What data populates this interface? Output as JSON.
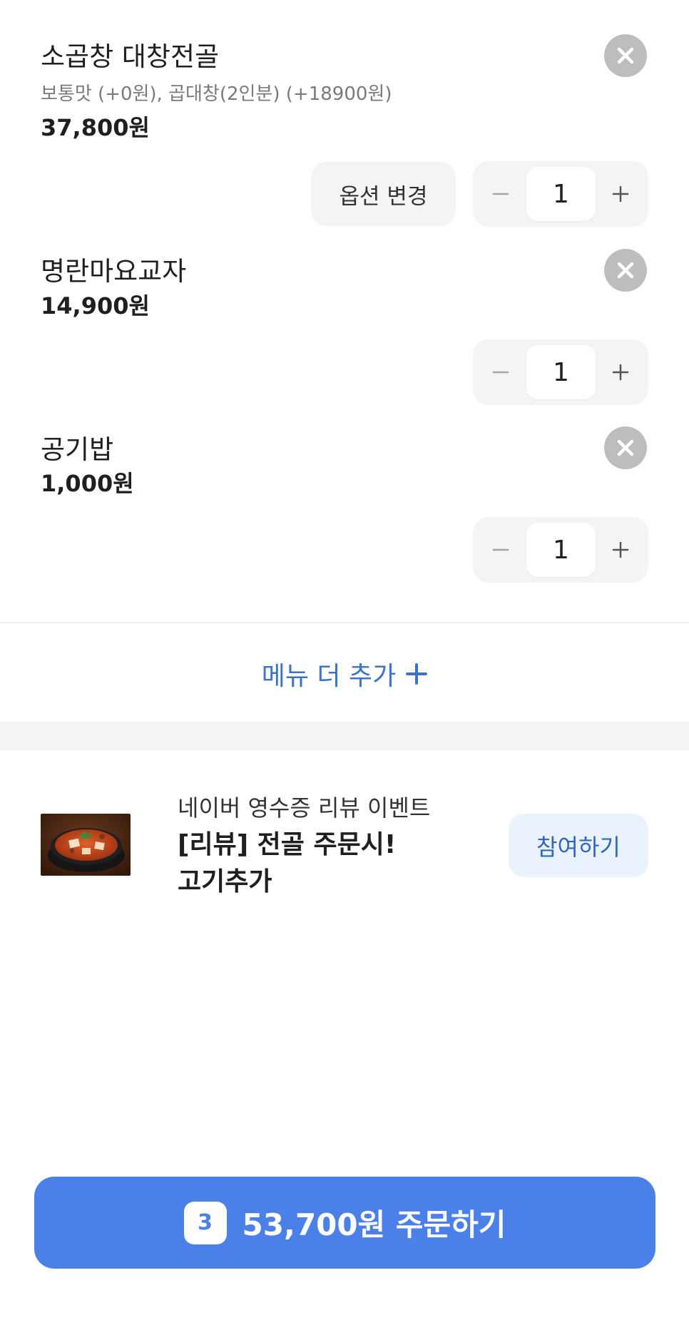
{
  "cart": {
    "items": [
      {
        "name": "소곱창 대창전골",
        "options": "보통맛 (+0원), 곱대창(2인분) (+18900원)",
        "price": "37,800원",
        "option_change_label": "옵션 변경",
        "quantity": "1"
      },
      {
        "name": "명란마요교자",
        "price": "14,900원",
        "quantity": "1"
      },
      {
        "name": "공기밥",
        "price": "1,000원",
        "quantity": "1"
      }
    ],
    "add_menu_label": "메뉴 더 추가"
  },
  "event": {
    "source": "네이버 영수증 리뷰 이벤트",
    "title": "[리뷰] 전골 주문시! 고기추가",
    "join_label": "참여하기"
  },
  "order": {
    "count": "3",
    "label": "53,700원 주문하기"
  },
  "colors": {
    "accent": "#4a80e8",
    "link": "#3b73c8",
    "remove_button": "#bdbdbd",
    "control_bg": "#f2f4f6"
  },
  "icons": {
    "remove": "close-icon",
    "decrease": "minus-icon",
    "increase": "plus-icon",
    "add_menu": "plus-icon"
  }
}
